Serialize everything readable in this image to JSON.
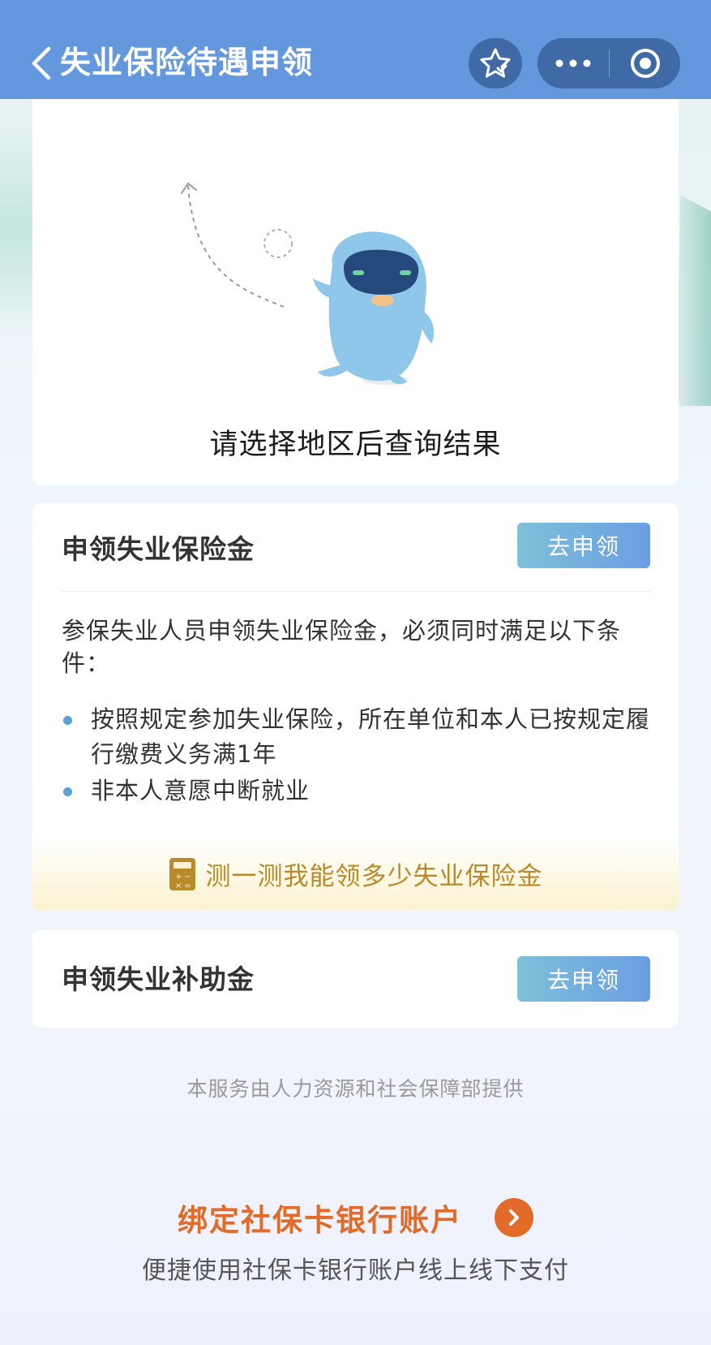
{
  "nav": {
    "title": "失业保险待遇申领",
    "back_icon": "chevron-left-icon",
    "favorite_icon": "star-icon",
    "more_icon": "more-dots-icon",
    "close_icon": "target-circle-icon",
    "bar_color": "#6398df",
    "capsule_color": "#3f6aa6"
  },
  "region_card": {
    "illustration_icon": "mascot-penguin-icon",
    "message": "请选择地区后查询结果"
  },
  "benefit_card": {
    "title": "申领失业保险金",
    "apply_label": "去申领",
    "intro": "参保失业人员申领失业保险金，必须同时满足以下条件：",
    "conditions": [
      "按照规定参加失业保险，所在单位和本人已按规定履行缴费义务满1年",
      "非本人意愿中断就业"
    ],
    "calculator_icon": "calculator-icon",
    "calculator_label": "测一测我能领多少失业保险金"
  },
  "subsidy_card": {
    "title": "申领失业补助金",
    "apply_label": "去申领"
  },
  "footer": {
    "provider": "本服务由人力资源和社会保障部提供",
    "bind_title": "绑定社保卡银行账户",
    "bind_icon": "chevron-right-circle-icon",
    "bind_subtitle": "便捷使用社保卡银行账户线上线下支付",
    "accent_color": "#e26b2a"
  }
}
